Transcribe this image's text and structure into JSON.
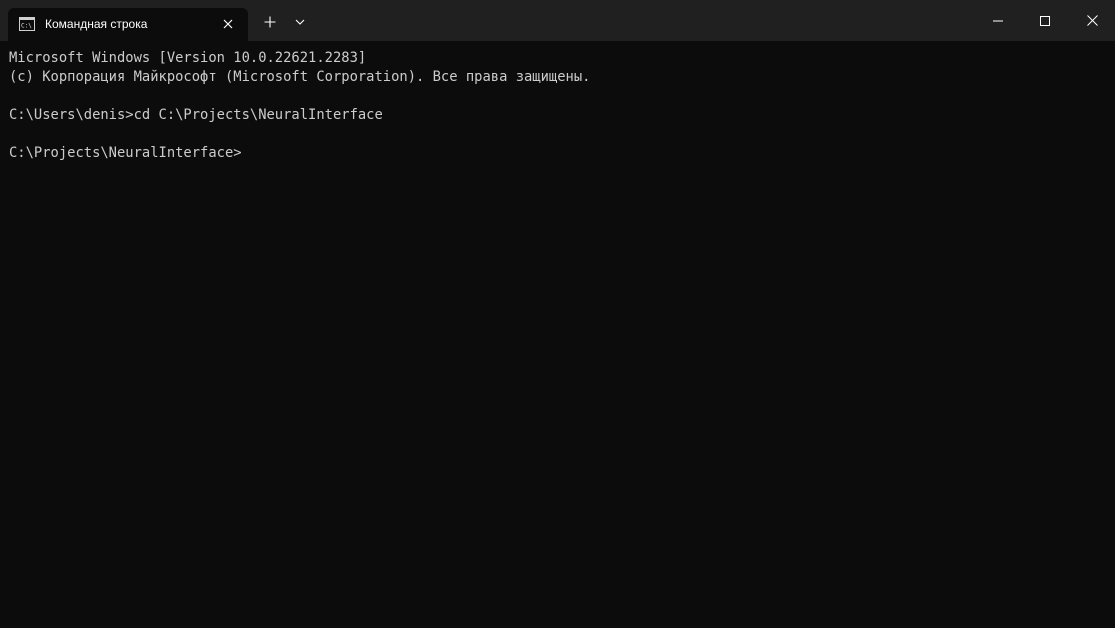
{
  "tab": {
    "title": "Командная строка",
    "icon": "cmd-icon"
  },
  "titlebar": {
    "new_tab": "+",
    "dropdown": "chevron-down-icon"
  },
  "window_controls": [
    "minimize-icon",
    "maximize-icon",
    "close-icon"
  ],
  "terminal": {
    "lines": [
      "Microsoft Windows [Version 10.0.22621.2283]",
      "(c) Корпорация Майкрософт (Microsoft Corporation). Все права защищены.",
      "",
      "C:\\Users\\denis>cd C:\\Projects\\NeuralInterface",
      "",
      "C:\\Projects\\NeuralInterface>"
    ]
  },
  "colors": {
    "titlebar_bg": "#202020",
    "terminal_bg": "#0c0c0c",
    "terminal_fg": "#cccccc",
    "title_fg": "#ffffff"
  }
}
